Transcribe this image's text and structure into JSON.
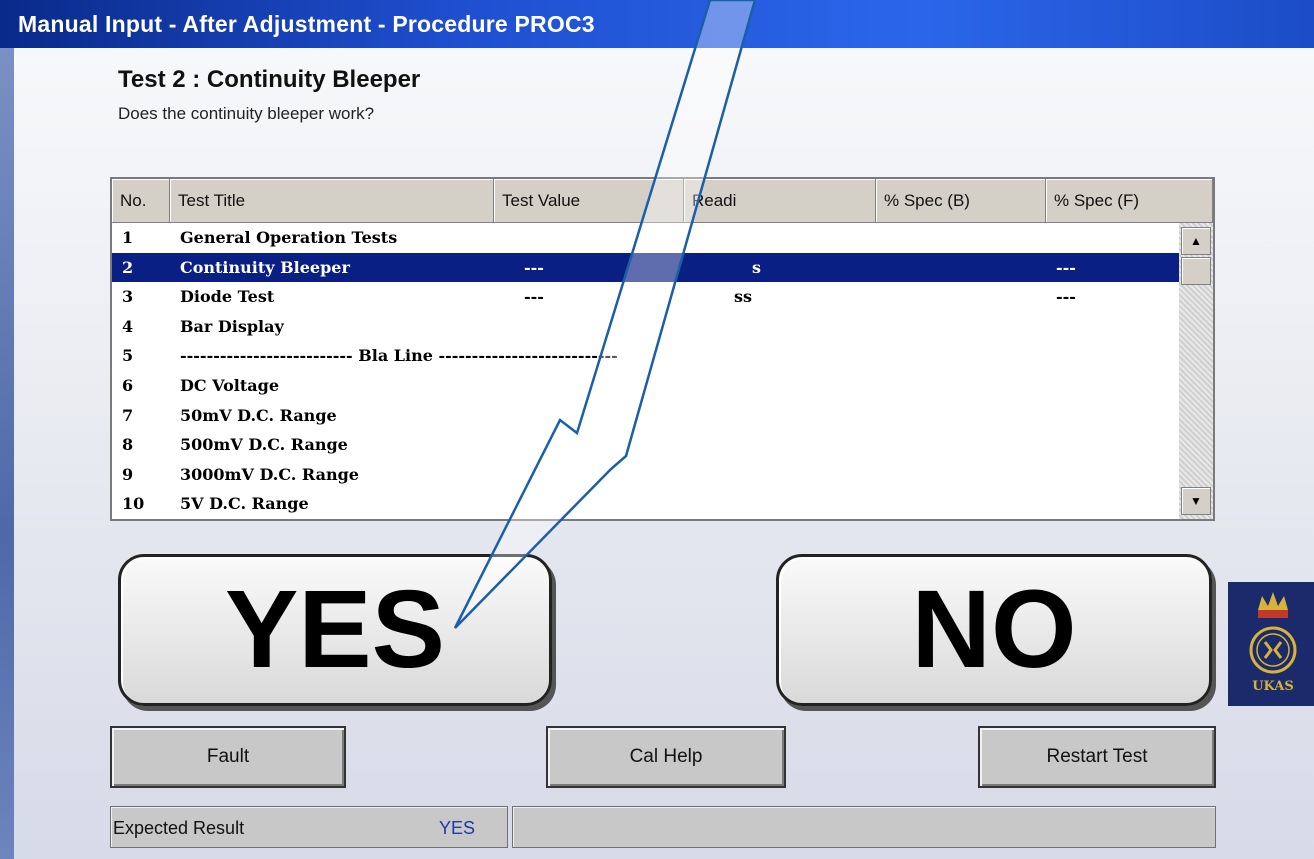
{
  "window": {
    "title": "Manual Input - After Adjustment - Procedure PROC3"
  },
  "test": {
    "title": "Test 2 : Continuity Bleeper",
    "question": "Does the continuity bleeper work?"
  },
  "grid": {
    "columns": [
      "No.",
      "Test Title",
      "Test Value",
      "Readi",
      "% Spec (B)",
      "% Spec (F)"
    ],
    "rows": [
      {
        "no": "1",
        "title": "General Operation Tests",
        "value": "",
        "reading": "",
        "specf": ""
      },
      {
        "no": "2",
        "title": "Continuity Bleeper",
        "value": "---",
        "reading": "s",
        "specf": "---",
        "selected": true
      },
      {
        "no": "3",
        "title": "Diode Test",
        "value": "---",
        "reading": "ss",
        "specf": "---"
      },
      {
        "no": "4",
        "title": "Bar Display",
        "value": "",
        "reading": "",
        "specf": ""
      },
      {
        "no": "5",
        "title": "-------------------------- Bla   Line ---------------------------",
        "value": "",
        "reading": "",
        "specf": ""
      },
      {
        "no": "6",
        "title": "DC Voltage",
        "value": "",
        "reading": "",
        "specf": ""
      },
      {
        "no": "7",
        "title": "50mV D.C. Range",
        "value": "",
        "reading": "",
        "specf": ""
      },
      {
        "no": "8",
        "title": "500mV D.C. Range",
        "value": "",
        "reading": "",
        "specf": ""
      },
      {
        "no": "9",
        "title": "3000mV D.C. Range",
        "value": "",
        "reading": "",
        "specf": ""
      },
      {
        "no": "10",
        "title": "5V D.C. Range",
        "value": "",
        "reading": "",
        "specf": ""
      }
    ]
  },
  "buttons": {
    "yes": "YES",
    "no": "NO",
    "fault": "Fault",
    "cal_help": "Cal Help",
    "restart": "Restart Test"
  },
  "status": {
    "label": "Expected Result",
    "value": "YES"
  },
  "logo": {
    "text": "UKAS",
    "icon": "ukas-crown-logo"
  },
  "annotation": {
    "icon": "arrow-annotation",
    "color": "#1a5fa8"
  },
  "colors": {
    "titlebar": "#1f4fd0",
    "selection": "#0a1f84",
    "status_value": "#1c3aa8"
  }
}
